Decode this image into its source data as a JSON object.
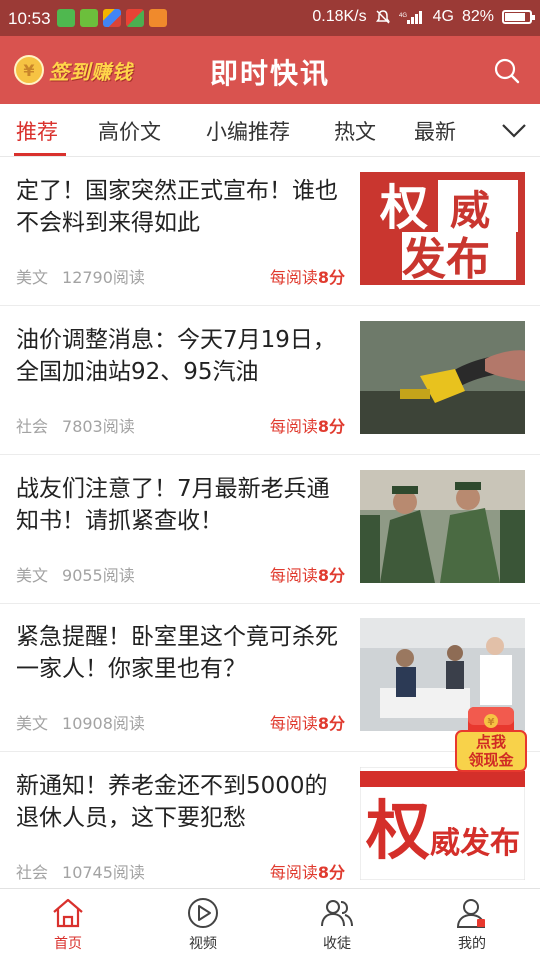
{
  "status_bar": {
    "time": "10:53",
    "net_speed": "0.18K/s",
    "network": "4G",
    "battery": "82%",
    "battery_level": 0.82
  },
  "header": {
    "signin_label": "签到赚钱",
    "coin_symbol": "¥",
    "title": "即时快讯",
    "bg_color": "#d9534f"
  },
  "tabs": [
    "推荐",
    "高价文",
    "小编推荐",
    "热文",
    "最新"
  ],
  "active_tab_color": "#d9312d",
  "articles": [
    {
      "title": "定了！国家突然正式宣布！谁也不会料到来得如此",
      "category": "美文",
      "reads": "12790阅读",
      "reward_prefix": "每阅读",
      "reward_value": "8分",
      "thumb_text": [
        "权",
        "威",
        "发布"
      ]
    },
    {
      "title": "油价调整消息：今天7月19日，全国加油站92、95汽油",
      "category": "社会",
      "reads": "7803阅读",
      "reward_prefix": "每阅读",
      "reward_value": "8分"
    },
    {
      "title": "战友们注意了！7月最新老兵通知书！请抓紧查收！",
      "category": "美文",
      "reads": "9055阅读",
      "reward_prefix": "每阅读",
      "reward_value": "8分"
    },
    {
      "title": "紧急提醒！卧室里这个竟可杀死一家人！你家里也有？",
      "category": "美文",
      "reads": "10908阅读",
      "reward_prefix": "每阅读",
      "reward_value": "8分"
    },
    {
      "title": "新通知！养老金还不到5000的退休人员，这下要犯愁",
      "category": "社会",
      "reads": "10745阅读",
      "reward_prefix": "每阅读",
      "reward_value": "8分",
      "thumb_text": [
        "权",
        "威发布"
      ]
    }
  ],
  "promo": {
    "line1": "点我",
    "line2": "领现金"
  },
  "bottom_nav": [
    "首页",
    "视频",
    "收徒",
    "我的"
  ]
}
